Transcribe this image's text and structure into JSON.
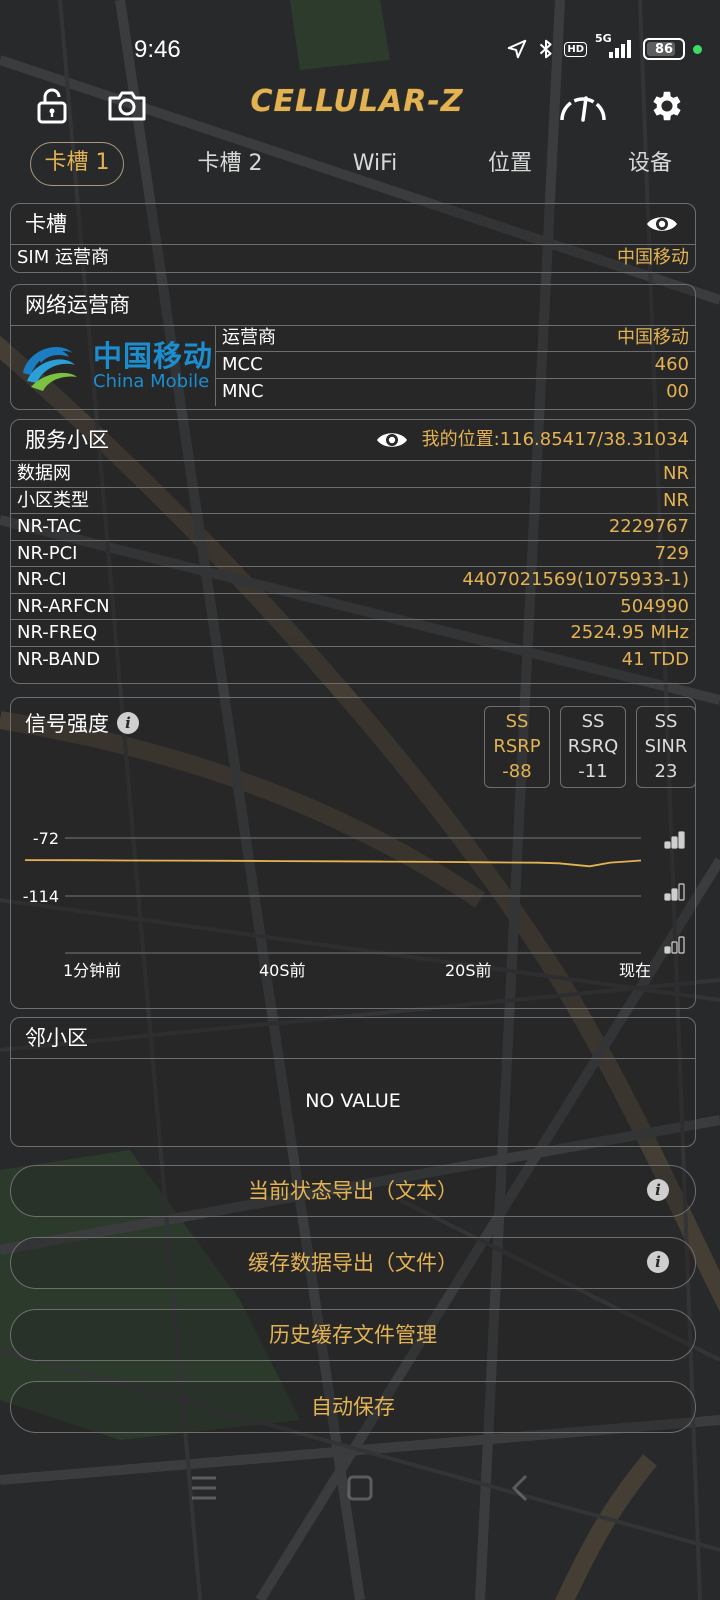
{
  "status_bar": {
    "time": "9:46",
    "hd": "HD",
    "net": "5G",
    "battery": "86",
    "battery_level": 0.86
  },
  "app": {
    "brand": "CELLULAR-Z",
    "icons": [
      "unlock-icon",
      "camera-icon",
      "speedometer-icon",
      "gear-icon"
    ]
  },
  "tabs": [
    "卡槽 1",
    "卡槽 2",
    "WiFi",
    "位置",
    "设备"
  ],
  "active_tab": 0,
  "slot_panel": {
    "title": "卡槽",
    "rows": [
      {
        "key": "SIM 运营商",
        "value": "中国移动"
      }
    ]
  },
  "operator_panel": {
    "title": "网络运营商",
    "logo_cn": "中国移动",
    "logo_en": "China Mobile",
    "rows": [
      {
        "key": "运营商",
        "value": "中国移动"
      },
      {
        "key": "MCC",
        "value": "460"
      },
      {
        "key": "MNC",
        "value": "00"
      }
    ]
  },
  "cell_panel": {
    "title": "服务小区",
    "location": "我的位置:116.85417/38.31034",
    "rows": [
      {
        "key": "数据网",
        "value": "NR"
      },
      {
        "key": "小区类型",
        "value": "NR"
      },
      {
        "key": "NR-TAC",
        "value": "2229767"
      },
      {
        "key": "NR-PCI",
        "value": "729"
      },
      {
        "key": "NR-CI",
        "value": "4407021569(1075933-1)"
      },
      {
        "key": "NR-ARFCN",
        "value": "504990"
      },
      {
        "key": "NR-FREQ",
        "value": "2524.95 MHz"
      },
      {
        "key": "NR-BAND",
        "value": "41 TDD"
      }
    ]
  },
  "signal_panel": {
    "title": "信号强度",
    "metrics": [
      {
        "line1": "SS",
        "line2": "RSRP",
        "line3": "-88",
        "color": "#e3b253"
      },
      {
        "line1": "SS",
        "line2": "RSRQ",
        "line3": "-11",
        "color": "#dcdcdc"
      },
      {
        "line1": "SS",
        "line2": "SINR",
        "line3": "23",
        "color": "#dcdcdc"
      }
    ]
  },
  "chart_data": {
    "type": "line",
    "y_ticks": [
      -72,
      -114
    ],
    "x_ticks": [
      "1分钟前",
      "40S前",
      "20S前",
      "现在"
    ],
    "series": [
      {
        "color": "#e3b253",
        "x": [
          0,
          5,
          10,
          15,
          20,
          25,
          30,
          35,
          40,
          45,
          50,
          52,
          55,
          57,
          60
        ],
        "values": [
          -88,
          -88.1,
          -88.3,
          -88.4,
          -88.5,
          -88.7,
          -88.9,
          -89.1,
          -89.3,
          -89.6,
          -89.9,
          -90.3,
          -92.5,
          -89.8,
          -88.3
        ]
      }
    ],
    "grid": true
  },
  "neighbor_panel": {
    "title": "邻小区",
    "empty_text": "NO VALUE"
  },
  "buttons": [
    {
      "label": "当前状态导出（文本）",
      "info": true
    },
    {
      "label": "缓存数据导出（文件）",
      "info": true
    },
    {
      "label": "历史缓存文件管理",
      "info": false
    },
    {
      "label": "自动保存",
      "info": false
    }
  ],
  "info_glyph": "i"
}
